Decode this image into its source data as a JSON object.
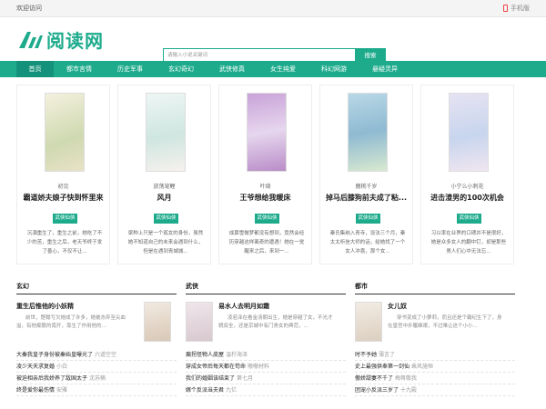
{
  "topbar": {
    "welcome": "欢迎访问",
    "mobile": "手机版"
  },
  "logo": {
    "text": "阅读网"
  },
  "search": {
    "placeholder": "请输入小说关键词",
    "button": "搜索"
  },
  "nav": [
    "首页",
    "都市言情",
    "历史军事",
    "玄幻奇幻",
    "武侠修真",
    "女生纯爱",
    "科幻网游",
    "悬疑灵异"
  ],
  "featured": [
    {
      "author": "初见",
      "title": "霸道娇夫娘子快到怀里来",
      "tag": "武侠仙侠",
      "desc": "沉湎重生了，重生之前，她吃了不少的苦，重生之后，老天爷终于发了善心，不仅不让..."
    },
    {
      "author": "放荡宠鲤",
      "title": "风月",
      "tag": "武侠仙侠",
      "desc": "梁种上只是一个孤女的身份，虽然她不知道自己的未来会遇到什么，但是在遇到青城城..."
    },
    {
      "author": "叶绮",
      "title": "王爷想给我暖床",
      "tag": "武侠仙侠",
      "desc": "成慕雪做梦都没有想到，竟然会经历穿越这样离奇的遭遇！她在一觉醒来之后，来到一..."
    },
    {
      "author": "鹿桃千岁",
      "title": "掉马后膝狗前夫成了粘...",
      "tag": "武侠仙侠",
      "desc": "秦氏集纳入青寺，设法三个月，秦太太听信大师的话，给她找了一个女人冲喜，那个女..."
    },
    {
      "author": "小宁么小刺花",
      "title": "进击渣男的100次机会",
      "tag": "武侠仙侠",
      "desc": "习以率在业界的口碑并不是很好，她是众多女人的翻中钉，却是那些男人们心中无法忘..."
    }
  ],
  "columns": [
    {
      "title": "玄幻",
      "lead": {
        "title": "重生后惟他的小妖精",
        "desc": "前世，楚翰亏欠她成了许多，她被冻弃至尖血溢，有他痴狠的南开，靠生了作用他的..."
      },
      "rows": [
        {
          "name": "大秦我皇子身份被秦始皇曝光了",
          "author": "六道空空"
        },
        {
          "name": "凌少天天求复婚",
          "author": "小白"
        },
        {
          "name": "被迫相亲后我娇养了敌国太子",
          "author": "沈苏楠"
        },
        {
          "name": "终是爱你最伤情",
          "author": "安雅"
        }
      ]
    },
    {
      "title": "武侠",
      "lead": {
        "title": "易水人去明月如霜",
        "desc": "凌若泽在看金汤朝出生，她是穿越了女，不光才貌双全，还是京城中有门贵女的典范，..."
      },
      "rows": [
        {
          "name": "瘸拐怪物人皮屋",
          "author": "温柠海泽"
        },
        {
          "name": "穿成女帝后每天都在苟命",
          "author": "嗷嗷材料"
        },
        {
          "name": "我们的婚姻该结束了",
          "author": "第七月"
        },
        {
          "name": "嫁个反派当夫君",
          "author": "九亿"
        }
      ]
    },
    {
      "title": "都市",
      "lead": {
        "title": "女儿奴",
        "desc": "穿书变成了小萝莉，而且还是个霸纪生下了，身在皇宫中步履维艰，不过难让这个小小..."
      },
      "rows": [
        {
          "name": "时不予她",
          "author": "薄言了"
        },
        {
          "name": "史上最强供奉第一剑仙",
          "author": "乘风施恒"
        },
        {
          "name": "傲娇甜妻不千了",
          "author": "梅蒋敬我"
        },
        {
          "name": "团宠小反派三岁了",
          "author": "十九殿"
        }
      ]
    }
  ],
  "colors": {
    "accent": "#1dab8c",
    "nav_active": "#14917a"
  }
}
